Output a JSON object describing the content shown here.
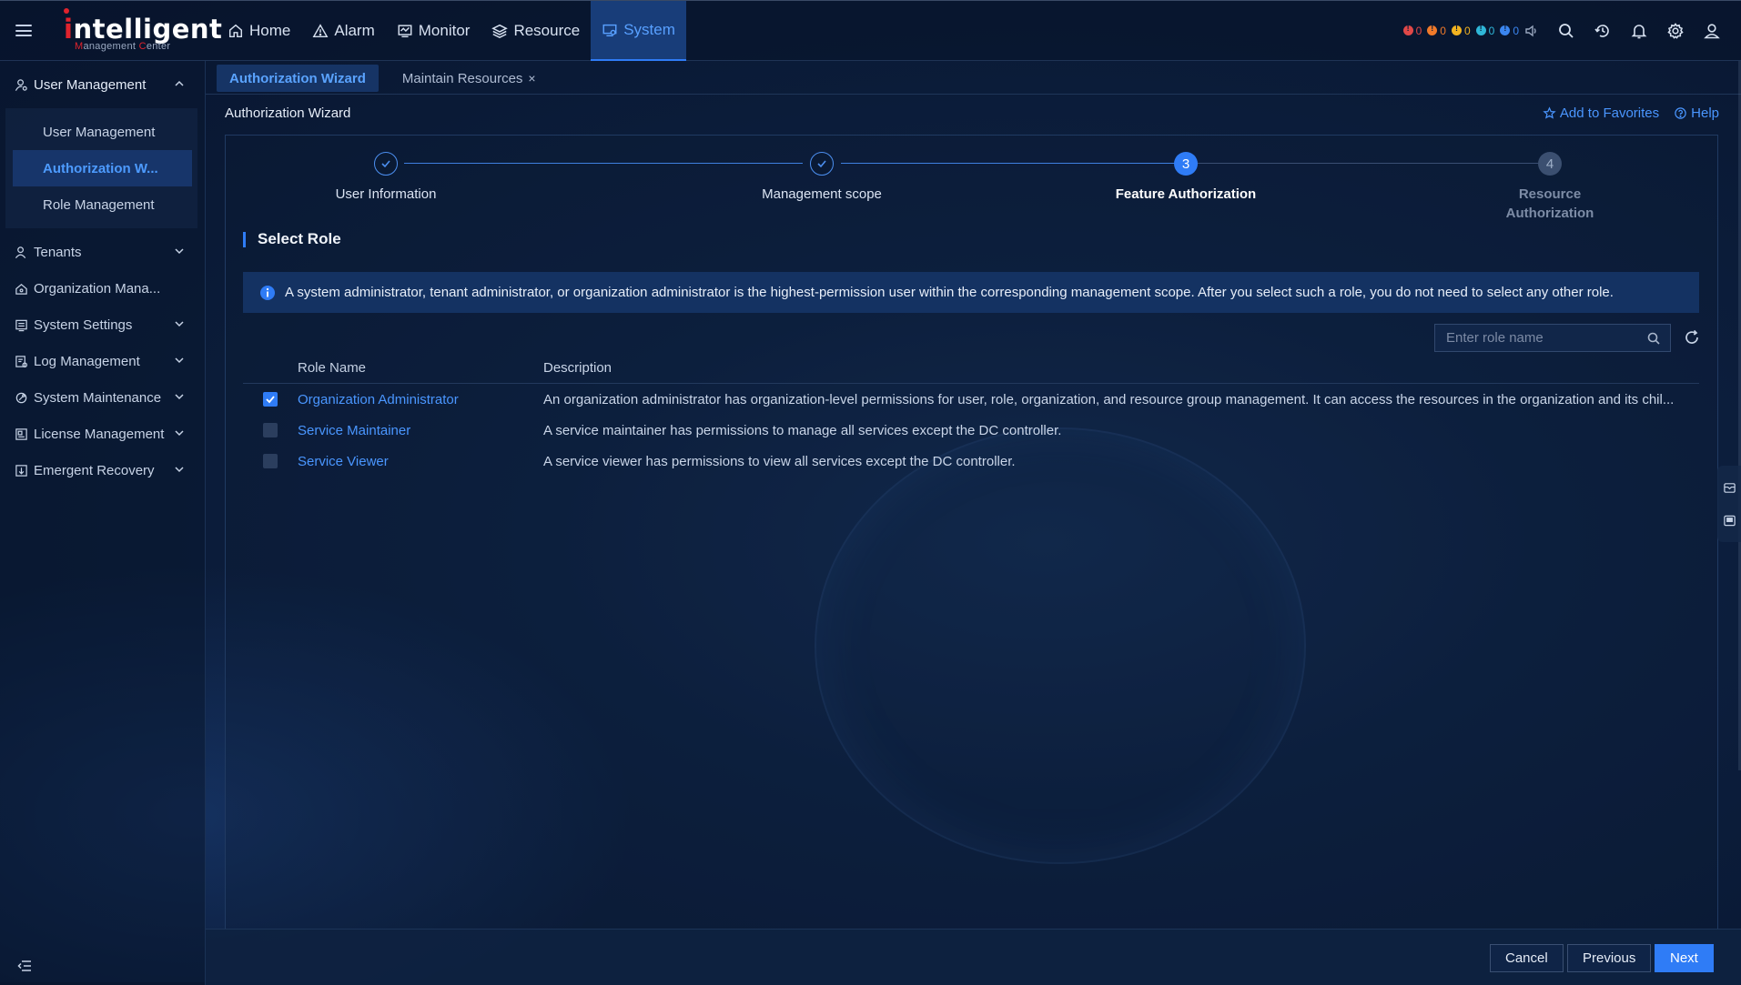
{
  "app": {
    "logo_main": "ntelligent",
    "logo_i": "i",
    "logo_sub_m": "M",
    "logo_sub_anagement": "anagement ",
    "logo_sub_c": "C",
    "logo_sub_enter": "enter"
  },
  "nav": {
    "items": [
      {
        "label": "Home",
        "icon": "home-icon"
      },
      {
        "label": "Alarm",
        "icon": "alarm-icon"
      },
      {
        "label": "Monitor",
        "icon": "monitor-icon"
      },
      {
        "label": "Resource",
        "icon": "layers-icon"
      },
      {
        "label": "System",
        "icon": "system-icon",
        "active": true
      }
    ]
  },
  "alarms": [
    {
      "count": "0",
      "color": "#e04848"
    },
    {
      "count": "0",
      "color": "#f07a2a"
    },
    {
      "count": "0",
      "color": "#f2b320"
    },
    {
      "count": "0",
      "color": "#2fb7d8"
    },
    {
      "count": "0",
      "color": "#3b86f0"
    }
  ],
  "sidebar": {
    "group": {
      "label": "User Management",
      "items": [
        {
          "label": "User Management"
        },
        {
          "label": "Authorization W...",
          "active": true
        },
        {
          "label": "Role Management"
        }
      ]
    },
    "items": [
      {
        "label": "Tenants"
      },
      {
        "label": "Organization Mana..."
      },
      {
        "label": "System Settings"
      },
      {
        "label": "Log Management"
      },
      {
        "label": "System Maintenance"
      },
      {
        "label": "License Management"
      },
      {
        "label": "Emergent Recovery"
      }
    ]
  },
  "tabs": [
    {
      "label": "Authorization Wizard",
      "active": true
    },
    {
      "label": "Maintain Resources",
      "close": "×"
    }
  ],
  "page": {
    "title": "Authorization Wizard",
    "favorites": "Add to Favorites",
    "help": "Help"
  },
  "steps": [
    {
      "label": "User Information",
      "state": "done"
    },
    {
      "label": "Management scope",
      "state": "done"
    },
    {
      "label": "Feature Authorization",
      "number": "3",
      "state": "current"
    },
    {
      "label": "Resource Authorization",
      "number": "4",
      "state": "todo"
    }
  ],
  "section": {
    "title": "Select Role",
    "info": "A system administrator, tenant administrator, or organization administrator is the highest-permission user within the corresponding management scope. After you select such a role, you do not need to select any other role."
  },
  "search": {
    "placeholder": "Enter role name"
  },
  "table": {
    "headers": {
      "name": "Role Name",
      "description": "Description"
    },
    "rows": [
      {
        "name": "Organization Administrator",
        "description": "An organization administrator has organization-level permissions for user, role, organization, and resource group management. It can access the resources in the organization and its chil...",
        "checked": true
      },
      {
        "name": "Service Maintainer",
        "description": "A service maintainer has permissions to manage all services except the DC controller.",
        "checked": false
      },
      {
        "name": "Service Viewer",
        "description": "A service viewer has permissions to view all services except the DC controller.",
        "checked": false
      }
    ]
  },
  "footer": {
    "cancel": "Cancel",
    "previous": "Previous",
    "next": "Next"
  },
  "colors": {
    "accent": "#2f7cf6",
    "link": "#4a96ff",
    "brand_red": "#e0232d"
  }
}
